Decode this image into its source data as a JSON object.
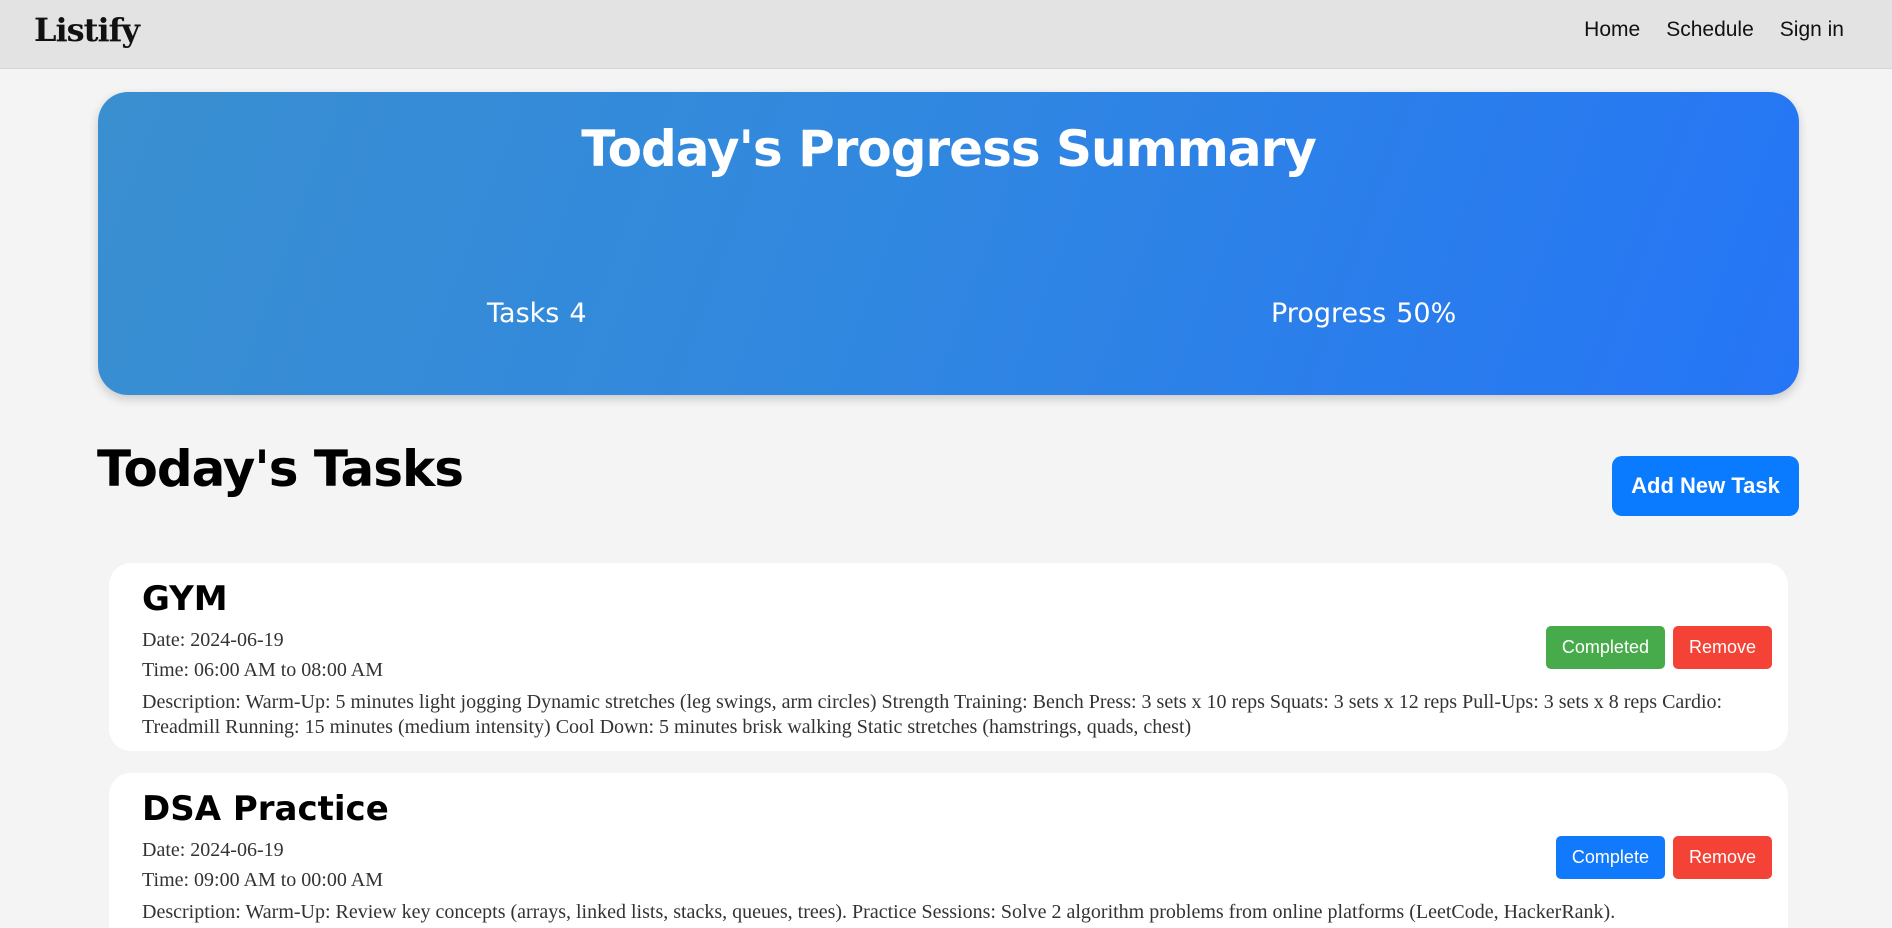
{
  "navbar": {
    "brand": "Listify",
    "links": [
      "Home",
      "Schedule",
      "Sign in"
    ]
  },
  "summary": {
    "title": "Today's Progress Summary",
    "tasks_label": "Tasks",
    "tasks_value": "4",
    "progress_label": "Progress",
    "progress_value": "50%"
  },
  "tasks_section": {
    "title": "Today's Tasks",
    "add_button": "Add New Task"
  },
  "tasks": [
    {
      "name": "GYM",
      "date": "Date: 2024-06-19",
      "time": "Time: 06:00 AM to 08:00 AM",
      "description": "Description: Warm-Up: 5 minutes light jogging Dynamic stretches (leg swings, arm circles) Strength Training: Bench Press: 3 sets x 10 reps Squats: 3 sets x 12 reps Pull-Ups: 3 sets x 8 reps Cardio: Treadmill Running: 15 minutes (medium intensity) Cool Down: 5 minutes brisk walking Static stretches (hamstrings, quads, chest)",
      "status_button": "Completed",
      "remove_button": "Remove",
      "status_color": "#47aa4b"
    },
    {
      "name": "DSA Practice",
      "date": "Date: 2024-06-19",
      "time": "Time: 09:00 AM to 00:00 AM",
      "description": "Description: Warm-Up: Review key concepts (arrays, linked lists, stacks, queues, trees). Practice Sessions: Solve 2 algorithm problems from online platforms (LeetCode, HackerRank).",
      "status_button": "Complete",
      "remove_button": "Remove",
      "status_color": "#1079fc"
    }
  ],
  "colors": {
    "accent": "#0a7bff",
    "remove": "#f44336",
    "hero_gradient_start": "#3a8fd0",
    "hero_gradient_end": "#2575f6"
  }
}
